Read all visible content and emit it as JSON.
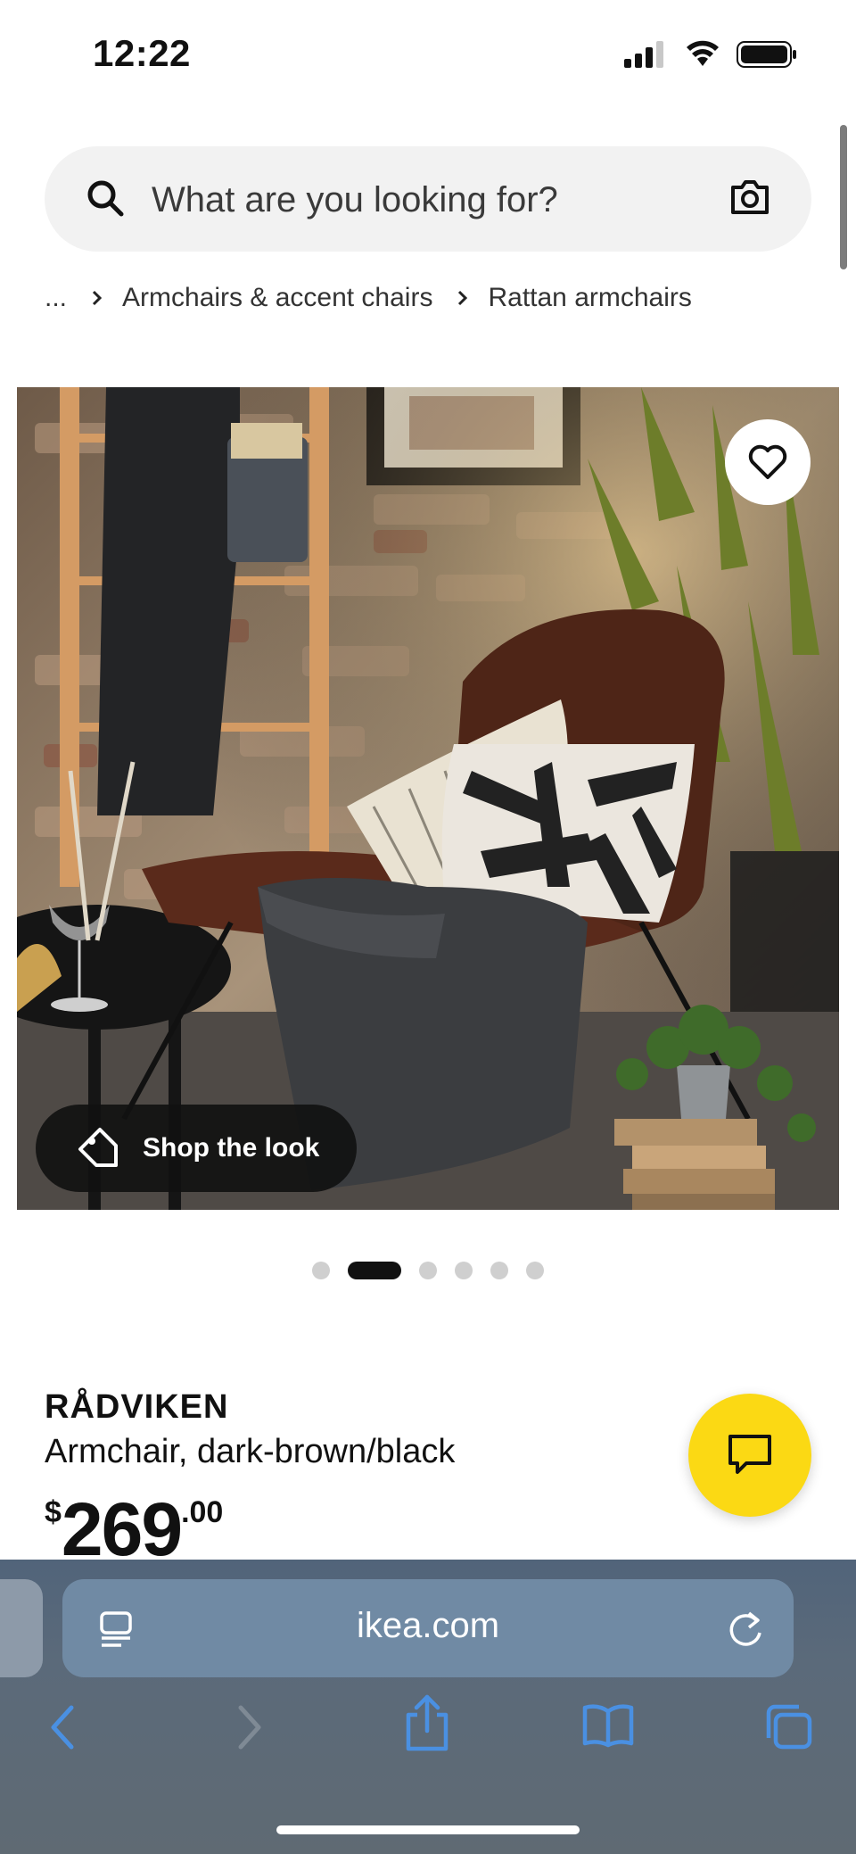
{
  "status_bar": {
    "time": "12:22"
  },
  "search": {
    "placeholder": "What are you looking for?"
  },
  "breadcrumb": {
    "ellipsis": "...",
    "items": [
      "Armchairs & accent chairs",
      "Rattan armchairs"
    ]
  },
  "hero": {
    "shop_the_look_label": "Shop the look",
    "carousel": {
      "total": 6,
      "active_index": 1
    }
  },
  "product": {
    "name": "RÅDVIKEN",
    "description": "Armchair, dark-brown/black",
    "price": {
      "currency": "$",
      "integer": "269",
      "decimal": ".00"
    }
  },
  "browser": {
    "url": "ikea.com"
  },
  "colors": {
    "chat_button": "#fbd914",
    "safari_accent": "#4a90e2"
  },
  "icons": [
    "search-icon",
    "camera-icon",
    "heart-icon",
    "tag-icon",
    "chat-icon",
    "reader-icon",
    "reload-icon",
    "back-icon",
    "forward-icon",
    "share-icon",
    "bookmarks-icon",
    "tabs-icon"
  ]
}
